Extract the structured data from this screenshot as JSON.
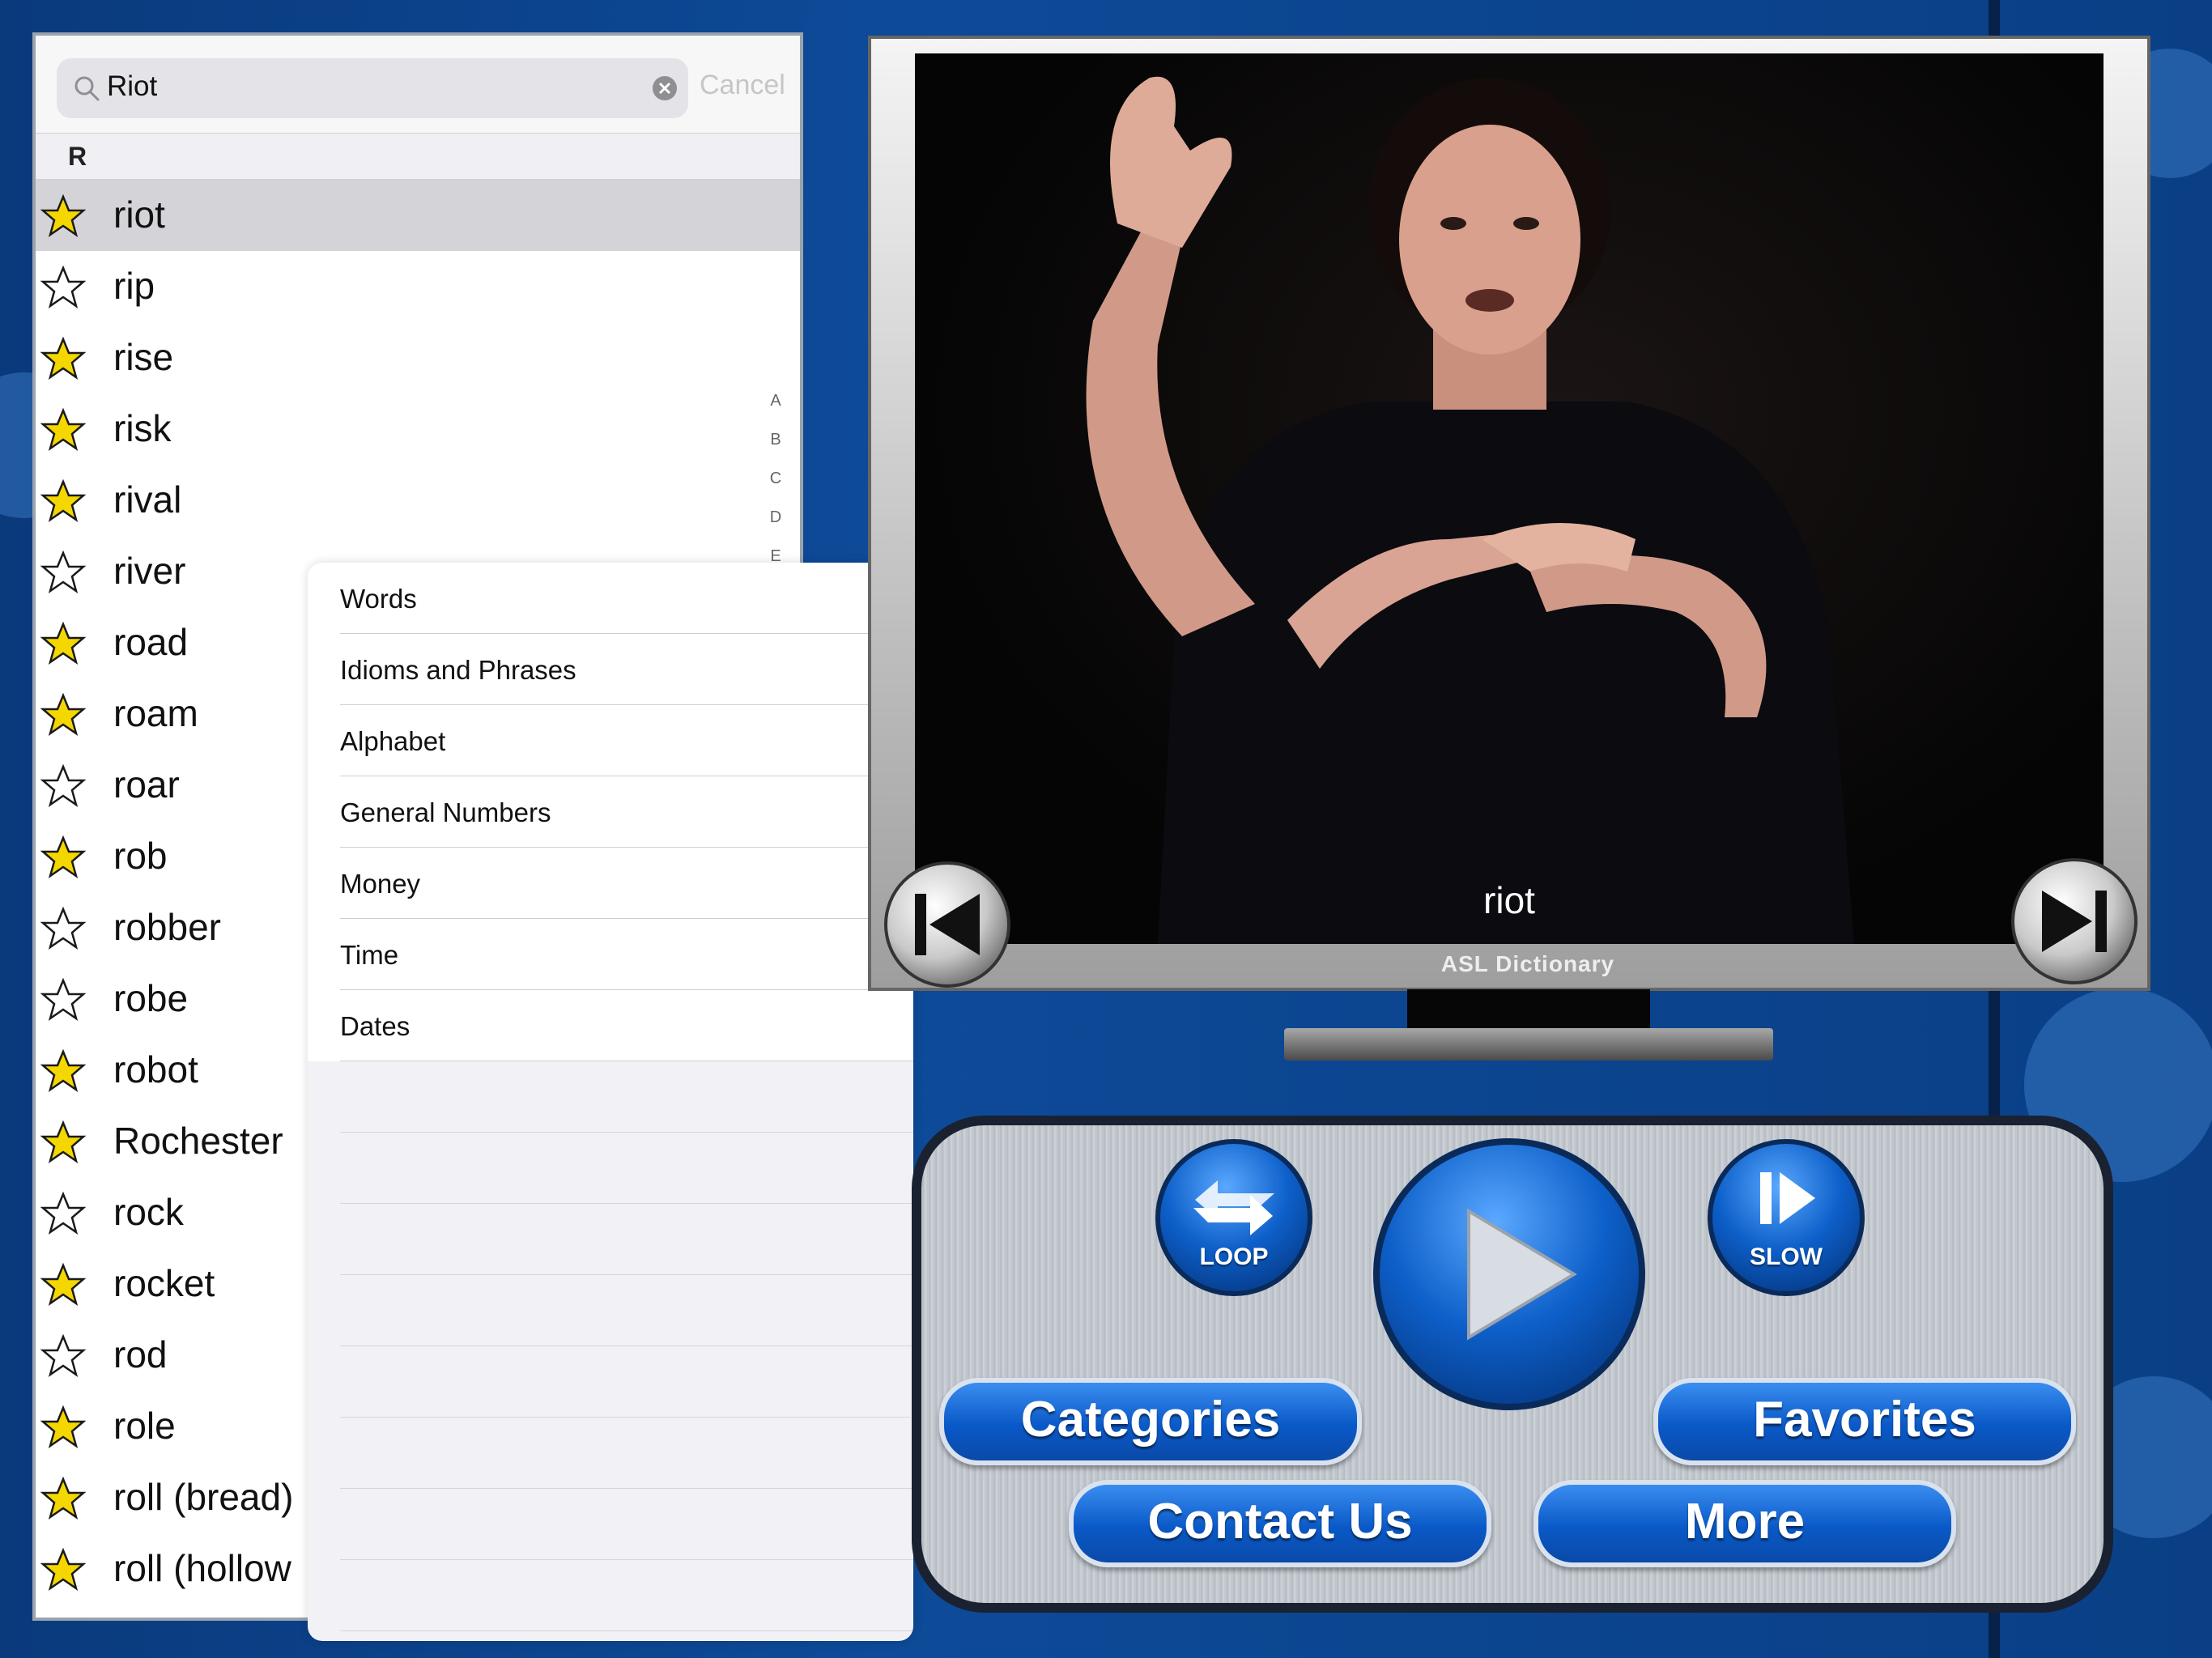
{
  "search": {
    "value": "Riot",
    "cancel_label": "Cancel"
  },
  "word_list": {
    "section": "R",
    "index_letters": [
      "A",
      "B",
      "C",
      "D",
      "E"
    ],
    "items": [
      {
        "label": "riot",
        "favorite": true,
        "selected": true
      },
      {
        "label": "rip",
        "favorite": false
      },
      {
        "label": "rise",
        "favorite": true
      },
      {
        "label": "risk",
        "favorite": true
      },
      {
        "label": "rival",
        "favorite": true
      },
      {
        "label": "river",
        "favorite": false
      },
      {
        "label": "road",
        "favorite": true
      },
      {
        "label": "roam",
        "favorite": true
      },
      {
        "label": "roar",
        "favorite": false
      },
      {
        "label": "rob",
        "favorite": true
      },
      {
        "label": "robber",
        "favorite": false
      },
      {
        "label": "robe",
        "favorite": false
      },
      {
        "label": "robot",
        "favorite": true
      },
      {
        "label": "Rochester",
        "favorite": true
      },
      {
        "label": "rock",
        "favorite": false
      },
      {
        "label": "rocket",
        "favorite": true
      },
      {
        "label": "rod",
        "favorite": false
      },
      {
        "label": "role",
        "favorite": true
      },
      {
        "label": "roll (bread)",
        "favorite": true
      },
      {
        "label": "roll (hollow",
        "favorite": true
      }
    ]
  },
  "categories_menu": {
    "items": [
      "Words",
      "Idioms and Phrases",
      "Alphabet",
      "General Numbers",
      "Money",
      "Time",
      "Dates"
    ]
  },
  "player": {
    "caption": "riot",
    "brand": "ASL Dictionary"
  },
  "controls": {
    "loop_label": "LOOP",
    "slow_label": "SLOW",
    "categories_label": "Categories",
    "favorites_label": "Favorites",
    "contact_label": "Contact Us",
    "more_label": "More"
  },
  "icons": {
    "star_filled": "star-filled-icon",
    "star_empty": "star-outline-icon",
    "search": "search-icon",
    "clear": "clear-icon",
    "previous": "skip-previous-icon",
    "next": "skip-next-icon",
    "play": "play-icon",
    "loop": "loop-icon",
    "slow": "slow-motion-icon"
  },
  "colors": {
    "accent_blue": "#0a59c8",
    "star_yellow": "#f5d700",
    "background": "#0b3f86"
  }
}
